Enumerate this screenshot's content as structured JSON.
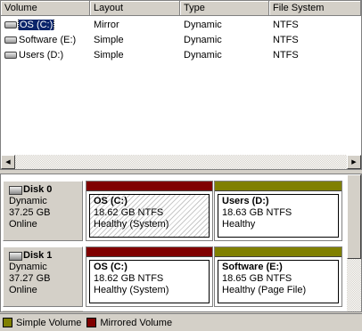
{
  "volume_list": {
    "columns": [
      "Volume",
      "Layout",
      "Type",
      "File System"
    ],
    "rows": [
      {
        "volume": "OS (C:)",
        "layout": "Mirror",
        "type": "Dynamic",
        "fs": "NTFS",
        "icon": "disk-icon",
        "selected": true
      },
      {
        "volume": "Software (E:)",
        "layout": "Simple",
        "type": "Dynamic",
        "fs": "NTFS",
        "icon": "disk-icon",
        "selected": false
      },
      {
        "volume": "Users (D:)",
        "layout": "Simple",
        "type": "Dynamic",
        "fs": "NTFS",
        "icon": "disk-icon",
        "selected": false
      }
    ]
  },
  "scroll": {
    "left_arrow": "◀",
    "right_arrow": "▶",
    "up_arrow": "▲",
    "down_arrow": "▼"
  },
  "disks": [
    {
      "name": "Disk 0",
      "type": "Dynamic",
      "size": "37.25 GB",
      "status": "Online",
      "partitions": [
        {
          "name": "OS  (C:)",
          "size": "18.62 GB NTFS",
          "status": "Healthy (System)",
          "kind": "mirrored",
          "hatched": true
        },
        {
          "name": "Users  (D:)",
          "size": "18.63 GB NTFS",
          "status": "Healthy",
          "kind": "simple",
          "hatched": false
        }
      ]
    },
    {
      "name": "Disk 1",
      "type": "Dynamic",
      "size": "37.27 GB",
      "status": "Online",
      "partitions": [
        {
          "name": "OS  (C:)",
          "size": "18.62 GB NTFS",
          "status": "Healthy (System)",
          "kind": "mirrored",
          "hatched": false
        },
        {
          "name": "Software  (E:)",
          "size": "18.65 GB NTFS",
          "status": "Healthy (Page File)",
          "kind": "simple",
          "hatched": false
        }
      ]
    }
  ],
  "legend": [
    {
      "label": "Simple Volume",
      "color": "#808000"
    },
    {
      "label": "Mirrored Volume",
      "color": "#800000"
    }
  ],
  "colors": {
    "simple": "#808000",
    "mirrored": "#800000",
    "selection": "#0a246a"
  }
}
